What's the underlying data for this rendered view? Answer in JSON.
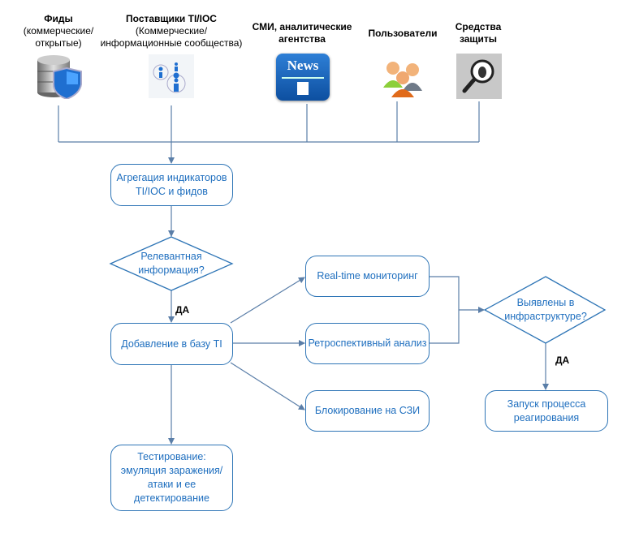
{
  "sources": [
    {
      "title": "Фиды",
      "subtitle": "(коммерческие/ открытые)",
      "icon": "database-shield-icon"
    },
    {
      "title": "Поставщики TI/IOC",
      "subtitle": "(Коммерческие/ информационные сообщества)",
      "icon": "info-network-icon"
    },
    {
      "title": "СМИ, аналитические агентства",
      "subtitle": "",
      "icon": "news-icon"
    },
    {
      "title": "Пользователи",
      "subtitle": "",
      "icon": "users-icon"
    },
    {
      "title": "Средства защиты",
      "subtitle": "",
      "icon": "bug-magnifier-icon"
    }
  ],
  "news_icon_text": "News",
  "nodes": {
    "aggregation": "Агрегация индикаторов TI/IOC и фидов",
    "relevant": "Релевантная информация?",
    "add_to_db": "Добавление в базу TI",
    "realtime": "Real-time мониторинг",
    "retro": "Ретроспективный анализ",
    "blocking": "Блокирование на СЗИ",
    "testing": "Тестирование: эмуляция заражения/ атаки и ее детектирование",
    "detected": "Выявлены в инфраструктуре?",
    "response": "Запуск процесса реагирования"
  },
  "labels": {
    "yes1": "ДА",
    "yes2": "ДА"
  },
  "colors": {
    "node_stroke": "#2e75b6",
    "node_text": "#1f6fbf",
    "connector": "#5a7ea8"
  }
}
